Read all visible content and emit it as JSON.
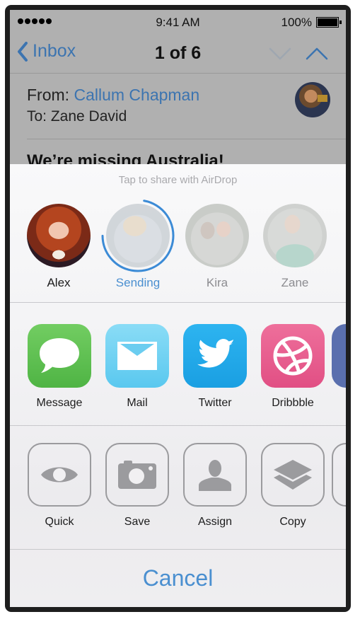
{
  "status_bar": {
    "signal_dots": 5,
    "time": "9:41 AM",
    "battery_percent": "100%",
    "battery_level": 1.0
  },
  "nav_bar": {
    "back_label": "Inbox",
    "title": "1 of 6"
  },
  "message": {
    "from_label": "From:",
    "from_name": "Callum Chapman",
    "to_label": "To:",
    "to_name": "Zane David",
    "subject": "We’re missing Australia!"
  },
  "share_sheet": {
    "airdrop_hint": "Tap to share with AirDrop",
    "airdrop_people": [
      {
        "name": "Alex",
        "state": "available"
      },
      {
        "name": "Sending",
        "state": "sending",
        "progress": 0.72
      },
      {
        "name": "Kira",
        "state": "faded"
      },
      {
        "name": "Zane",
        "state": "faded"
      }
    ],
    "apps": [
      {
        "label": "Message",
        "icon": "speech-bubble-icon",
        "color": "#5fc053"
      },
      {
        "label": "Mail",
        "icon": "envelope-icon",
        "color": "#6fd2f2"
      },
      {
        "label": "Twitter",
        "icon": "twitter-bird-icon",
        "color": "#22a9ea"
      },
      {
        "label": "Dribbble",
        "icon": "dribbble-ball-icon",
        "color": "#e85d8e"
      },
      {
        "label": "",
        "icon": "facebook-icon",
        "color": "#5a6fae"
      }
    ],
    "actions": [
      {
        "label": "Quick",
        "icon": "eye-icon"
      },
      {
        "label": "Save",
        "icon": "camera-icon"
      },
      {
        "label": "Assign",
        "icon": "person-icon"
      },
      {
        "label": "Copy",
        "icon": "layers-icon"
      },
      {
        "label": "",
        "icon": "more-action-icon"
      }
    ],
    "cancel_label": "Cancel"
  },
  "colors": {
    "accent": "#4a8fd0",
    "link": "#3c74b0",
    "icon_gray": "#9b9b9e"
  }
}
